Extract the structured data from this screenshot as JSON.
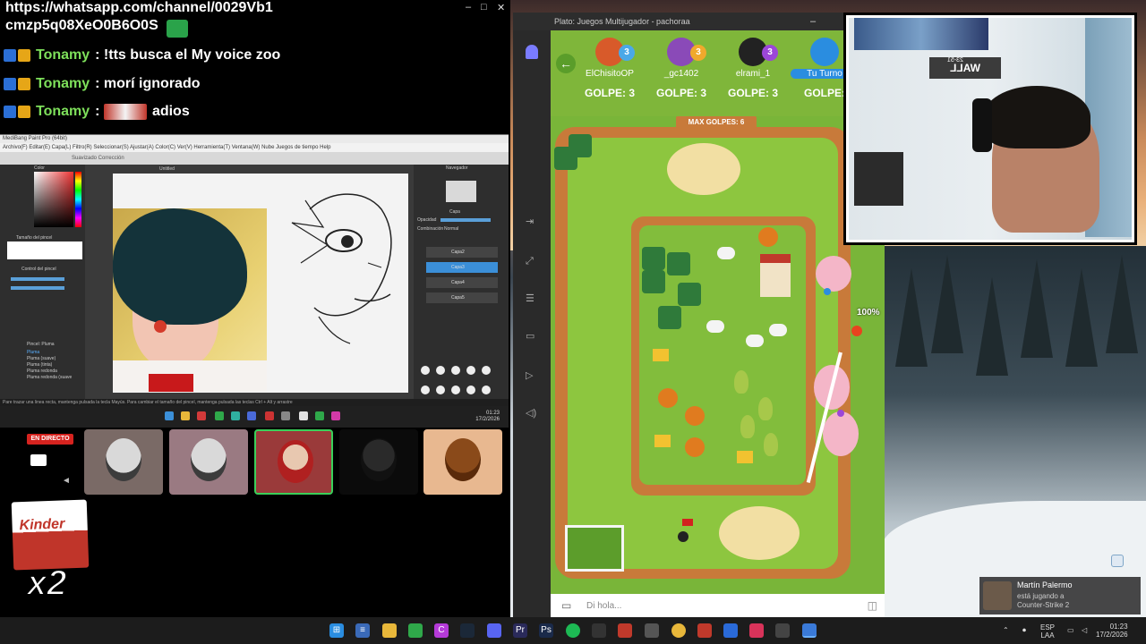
{
  "chat": {
    "url_line1": "https://whatsapp.com/channel/0029Vb1",
    "url_line2": "cmzp5q08XeO0B6O0S",
    "messages": [
      {
        "user": "Tonamy",
        "text": ": !tts busca el My voice zoo"
      },
      {
        "user": "Tonamy",
        "text": ": morí ignorado"
      },
      {
        "user": "Tonamy",
        "text": "adios"
      }
    ]
  },
  "paint": {
    "title": "MediBang Paint Pro (64bit)",
    "menu": "Archivo(F)  Editar(E)  Capa(L)  Filtro(R)  Seleccionar(S)  Ajustar(A)  Color(C)  Ver(V)  Herramienta(T)  Ventana(W)  Nube  Juegos de tiempo  Help",
    "tool_text": "Suavizado  Corrección",
    "canvas_label": "Untitled",
    "panel_color": "Color",
    "panel_brush_size": "Tamaño del pincel",
    "panel_brush_ctrl": "Control del pincel",
    "panel_navigator": "Navegador",
    "panel_layer": "Capa",
    "opacity_label": "Opacidad",
    "blend_label": "Combinación",
    "blend_value": "Normal",
    "layers": [
      "Capa2",
      "Capa3",
      "Capa4",
      "Capa5"
    ],
    "selected_layer": "Capa3",
    "brushes": [
      "Pluma",
      "Pluma (suave)",
      "Pluma (tinta)",
      "Pluma redonda",
      "Pluma redonda (suave"
    ],
    "brush_panel": "Pincel: Pluma",
    "status": "Pare trazar una linea recta, mantenga pulsada la tecla Mayús. Para cambiar el tamaño del pincel, mantenga pulsada las teclas Ctrl + Alt y arrastre",
    "taskbar_time": "01:23",
    "taskbar_date": "17/2/2026"
  },
  "discord": {
    "live_label": "EN DIRECTO",
    "tiles": [
      "cat-1",
      "cat-2",
      "cat-3",
      "user-dark",
      "dog"
    ]
  },
  "donation": {
    "brand": "Kinder",
    "multiplier": "x2"
  },
  "plato": {
    "window_title": "Plato: Juegos Multijugador - pachoraa",
    "players": [
      {
        "name": "ElChisitoOP",
        "count": "3",
        "golpe": "GOLPE: 3",
        "color": "#4aa8e8"
      },
      {
        "name": "_gc1402",
        "count": "3",
        "golpe": "GOLPE: 3",
        "color": "#f0a92c"
      },
      {
        "name": "elrami_1",
        "count": "3",
        "golpe": "GOLPE: 3",
        "color": "#9c46d8"
      },
      {
        "name": "Tu Turno",
        "count": "",
        "golpe": "GOLPE:",
        "color": "#2a8de0"
      }
    ],
    "max_golpes": "MAX GOLPES: 6",
    "power": "100%",
    "chat_placeholder": "Di hola..."
  },
  "webcam": {
    "sign_text": "WALL",
    "sign_small": "23-51"
  },
  "notification": {
    "name": "Martín Palermo",
    "line1": "está jugando a",
    "line2": "Counter-Strike 2"
  },
  "taskbar": {
    "lang": "ESP",
    "region": "LAA",
    "time": "01:23",
    "date": "17/2/2026"
  }
}
